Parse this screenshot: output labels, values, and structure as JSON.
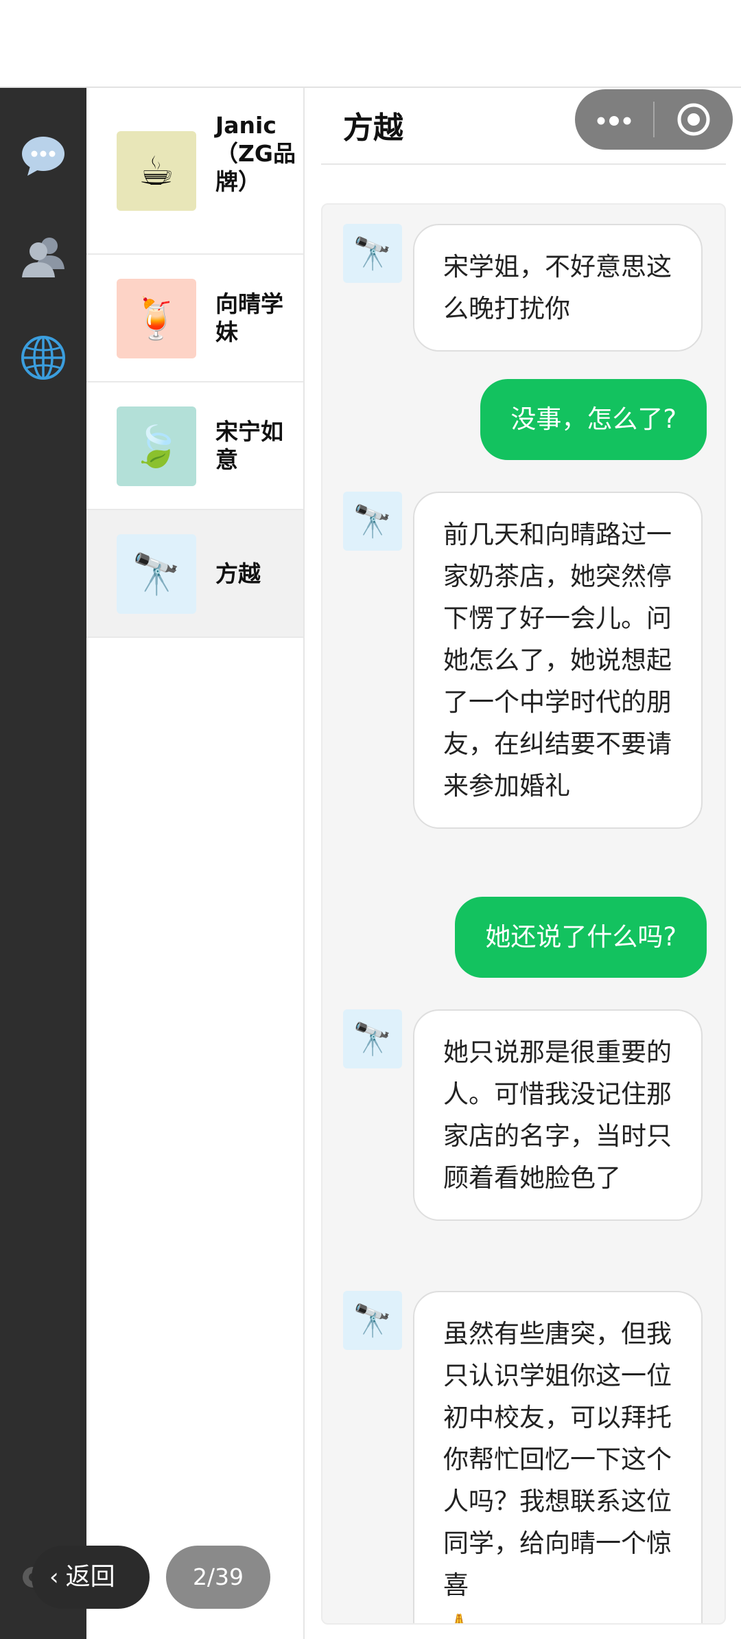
{
  "rail": {
    "icons": [
      "chat-bubble-icon",
      "contacts-icon",
      "globe-icon"
    ]
  },
  "contacts": [
    {
      "name": "Janic（ZG品牌）",
      "avatar": "☕",
      "avatar_bg": "#e8e6b8"
    },
    {
      "name": "向晴学妹",
      "avatar": "🍹",
      "avatar_bg": "#fdd3c6"
    },
    {
      "name": "宋宁如意",
      "avatar": "🍃",
      "avatar_bg": "#b3e0d8"
    },
    {
      "name": "方越",
      "avatar": "🔭",
      "avatar_bg": "#dff1fb",
      "active": true
    }
  ],
  "chat": {
    "title": "方越",
    "avatar": "🔭",
    "messages": [
      {
        "from": "in",
        "text": "宋学姐，不好意思这么晚打扰你"
      },
      {
        "from": "out",
        "text": "没事，怎么了?"
      },
      {
        "from": "in",
        "text": "前几天和向晴路过一家奶茶店，她突然停下愣了好一会儿。问她怎么了，她说想起了一个中学时代的朋友，在纠结要不要请来参加婚礼"
      },
      {
        "from": "out",
        "text": "她还说了什么吗?"
      },
      {
        "from": "in",
        "text": "她只说那是很重要的人。可惜我没记住那家店的名字，当时只顾着看她脸色了"
      },
      {
        "from": "in",
        "text": "虽然有些唐突，但我只认识学姐你这一位初中校友，可以拜托你帮忙回忆一下这个人吗？我想联系这位同学，给向晴一个惊喜"
      }
    ],
    "trailing_emoji": "🙏"
  },
  "footer": {
    "back_label": "返回",
    "page_label": "2/39"
  },
  "colors": {
    "rail": "#2e2e2e",
    "out_bubble": "#13c25f",
    "capsule": "#7f7f7f"
  }
}
